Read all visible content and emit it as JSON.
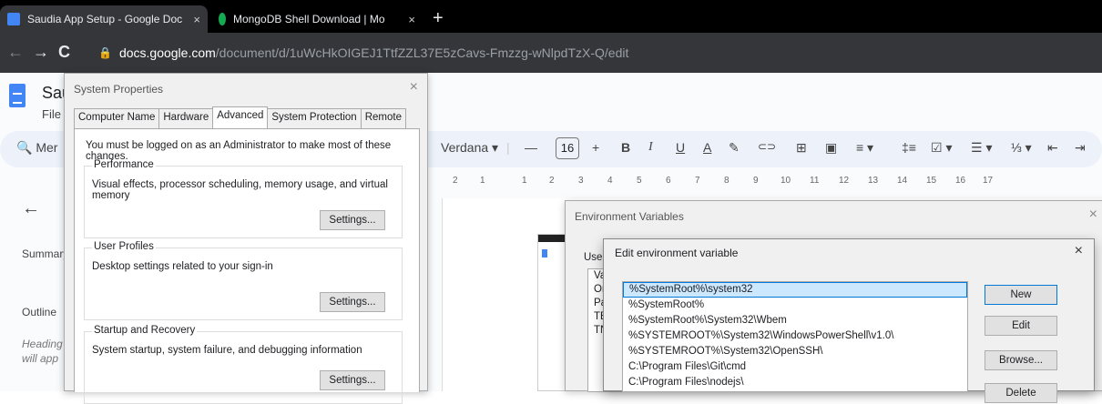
{
  "browser": {
    "tabs": [
      {
        "title": "Saudia App Setup - Google Doc",
        "close": "×",
        "favicon_color": "#4285f4",
        "active": true
      },
      {
        "title": "MongoDB Shell Download | Mo",
        "close": "×",
        "favicon_color": "#13aa52",
        "active": false
      }
    ],
    "new_tab": "+",
    "back": "←",
    "forward": "→",
    "reload": "C",
    "url_host": "docs.google.com",
    "url_path": "/document/d/1uWcHkOIGEJ1TtfZZL37E5zCavs-Fmzzg-wNlpdTzX-Q/edit"
  },
  "docs": {
    "title": "Sau",
    "menu_file": "File",
    "search": "Mer",
    "font_name": "Verdana ▾",
    "minus": "—",
    "font_size": "16",
    "plus": "+",
    "format_icons": [
      "B",
      "I",
      "U",
      "A",
      "✎",
      "⊂⊃",
      "⊞",
      "▣",
      "≡ ▾",
      "‡≡",
      "☑ ▾",
      "☰ ▾",
      "⅓ ▾",
      "⇤",
      "⇥"
    ],
    "ruler_numbers": [
      "2",
      "1",
      "1",
      "2",
      "3",
      "4",
      "5",
      "6",
      "7",
      "8",
      "9",
      "10",
      "11",
      "12",
      "13",
      "14",
      "15",
      "16",
      "17"
    ],
    "sidebar": {
      "back": "←",
      "summary": "Summary",
      "outline": "Outline",
      "hint_line1": "Heading",
      "hint_line2": "will app"
    }
  },
  "system_properties": {
    "title": "System Properties",
    "close": "×",
    "tabs": [
      "Computer Name",
      "Hardware",
      "Advanced",
      "System Protection",
      "Remote"
    ],
    "active_tab": "Advanced",
    "warning": "You must be logged on as an Administrator to make most of these changes.",
    "groups": [
      {
        "title": "Performance",
        "desc": "Visual effects, processor scheduling, memory usage, and virtual memory",
        "button": "Settings..."
      },
      {
        "title": "User Profiles",
        "desc": "Desktop settings related to your sign-in",
        "button": "Settings..."
      },
      {
        "title": "Startup and Recovery",
        "desc": "System startup, system failure, and debugging information",
        "button": "Settings..."
      }
    ]
  },
  "environment_variables": {
    "title": "Environment Variables",
    "close": "×",
    "user_label": "User",
    "list_fragments": [
      "Va",
      "Or",
      "Pa",
      "TE",
      "TN"
    ]
  },
  "edit_env": {
    "title": "Edit environment variable",
    "close": "×",
    "items": [
      "%SystemRoot%\\system32",
      "%SystemRoot%",
      "%SystemRoot%\\System32\\Wbem",
      "%SYSTEMROOT%\\System32\\WindowsPowerShell\\v1.0\\",
      "%SYSTEMROOT%\\System32\\OpenSSH\\",
      "C:\\Program Files\\Git\\cmd",
      "C:\\Program Files\\nodejs\\"
    ],
    "selected_index": 0,
    "buttons": {
      "new": "New",
      "edit": "Edit",
      "browse": "Browse...",
      "delete": "Delete"
    }
  }
}
